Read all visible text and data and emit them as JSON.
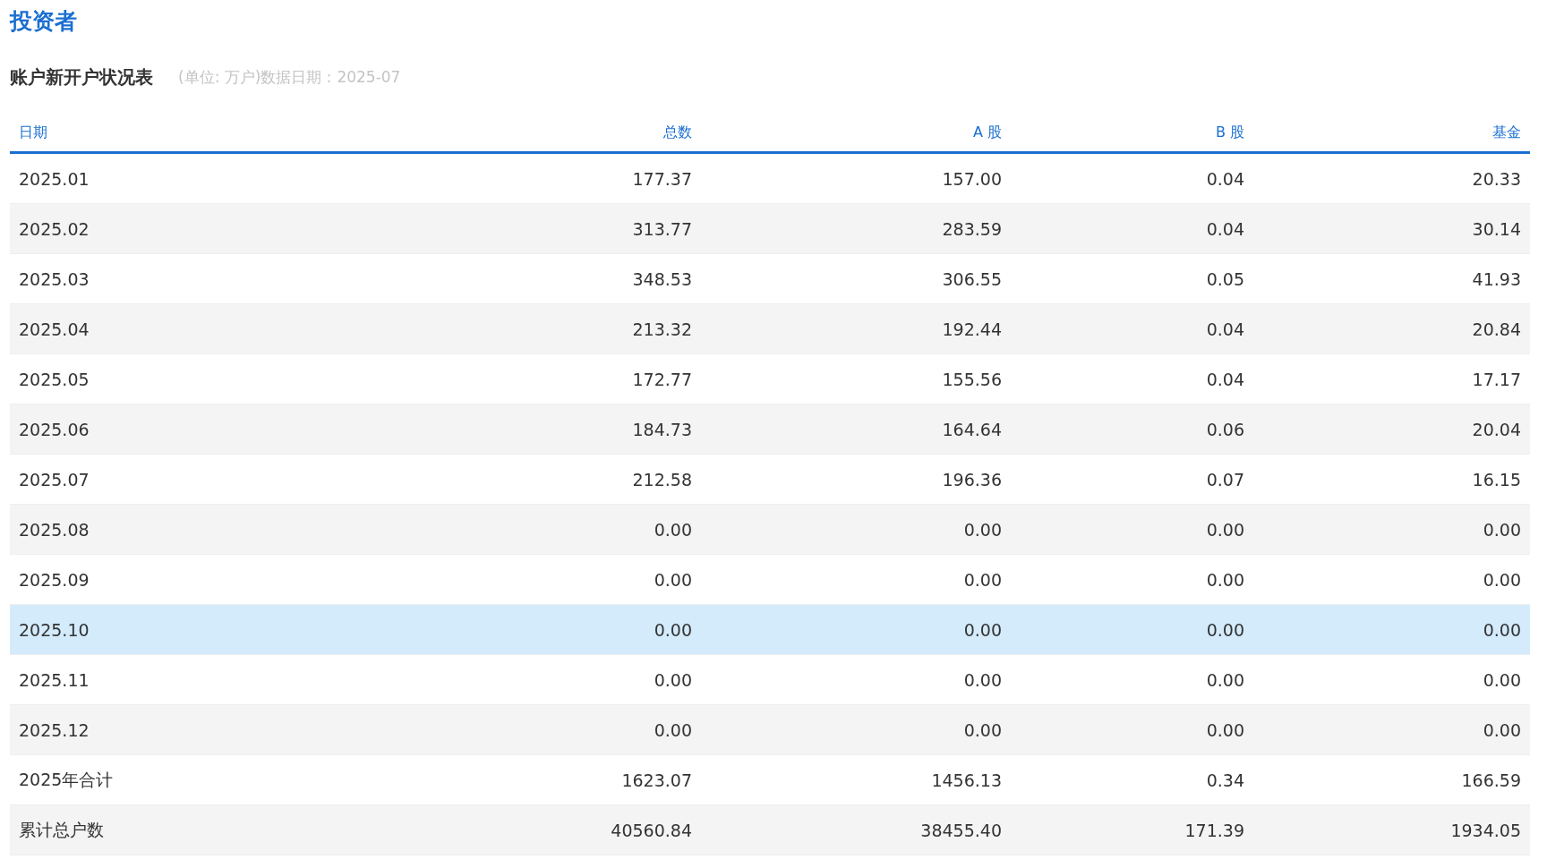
{
  "page_title": "投资者",
  "table_title": "账户新开户状况表",
  "table_note": "(单位: 万户)数据日期：2025-07",
  "table": {
    "columns": [
      "日期",
      "总数",
      "A 股",
      "B 股",
      "基金"
    ],
    "rows": [
      {
        "cells": [
          "2025.01",
          "177.37",
          "157.00",
          "0.04",
          "20.33"
        ],
        "selected": false
      },
      {
        "cells": [
          "2025.02",
          "313.77",
          "283.59",
          "0.04",
          "30.14"
        ],
        "selected": false
      },
      {
        "cells": [
          "2025.03",
          "348.53",
          "306.55",
          "0.05",
          "41.93"
        ],
        "selected": false
      },
      {
        "cells": [
          "2025.04",
          "213.32",
          "192.44",
          "0.04",
          "20.84"
        ],
        "selected": false
      },
      {
        "cells": [
          "2025.05",
          "172.77",
          "155.56",
          "0.04",
          "17.17"
        ],
        "selected": false
      },
      {
        "cells": [
          "2025.06",
          "184.73",
          "164.64",
          "0.06",
          "20.04"
        ],
        "selected": false
      },
      {
        "cells": [
          "2025.07",
          "212.58",
          "196.36",
          "0.07",
          "16.15"
        ],
        "selected": false
      },
      {
        "cells": [
          "2025.08",
          "0.00",
          "0.00",
          "0.00",
          "0.00"
        ],
        "selected": false
      },
      {
        "cells": [
          "2025.09",
          "0.00",
          "0.00",
          "0.00",
          "0.00"
        ],
        "selected": false
      },
      {
        "cells": [
          "2025.10",
          "0.00",
          "0.00",
          "0.00",
          "0.00"
        ],
        "selected": true
      },
      {
        "cells": [
          "2025.11",
          "0.00",
          "0.00",
          "0.00",
          "0.00"
        ],
        "selected": false
      },
      {
        "cells": [
          "2025.12",
          "0.00",
          "0.00",
          "0.00",
          "0.00"
        ],
        "selected": false
      },
      {
        "cells": [
          "2025年合计",
          "1623.07",
          "1456.13",
          "0.34",
          "166.59"
        ],
        "selected": false
      },
      {
        "cells": [
          "累计总户数",
          "40560.84",
          "38455.40",
          "171.39",
          "1934.05"
        ],
        "selected": false
      }
    ]
  }
}
